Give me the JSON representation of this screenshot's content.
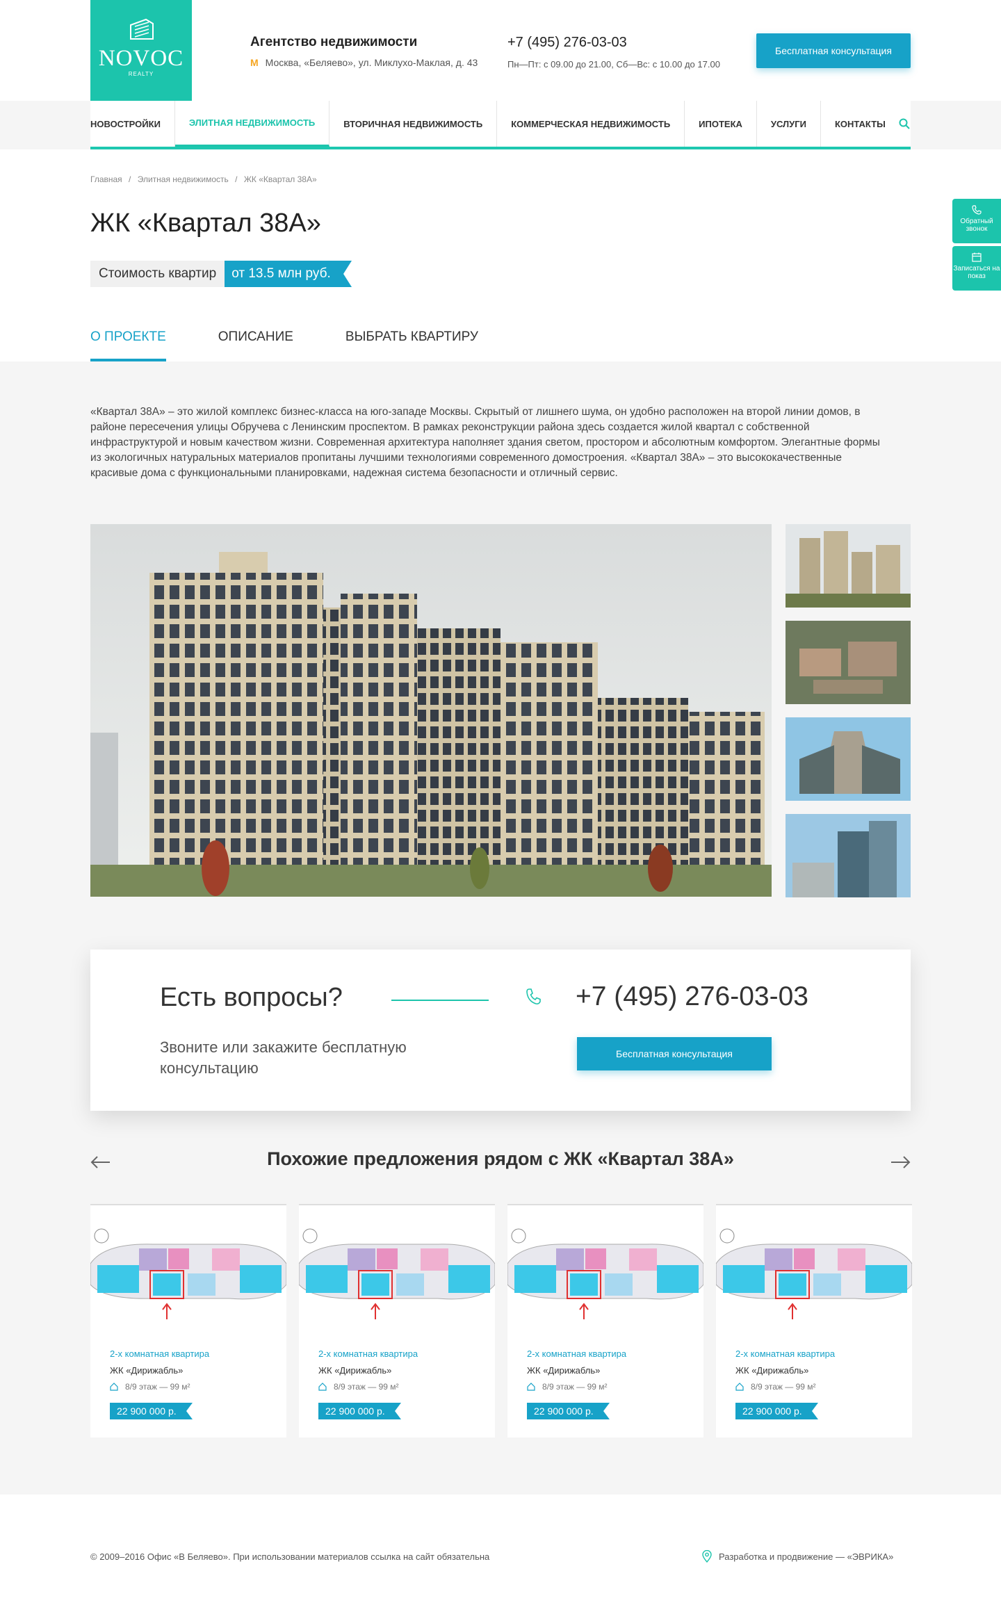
{
  "header": {
    "logo_name": "NOVOC",
    "logo_sub": "REALTY",
    "agency_title": "Агентство недвижимости",
    "metro": "М",
    "address": "Москва, «Беляево», ул. Миклухо-Маклая, д. 43",
    "phone": "+7 (495) 276-03-03",
    "hours": "Пн—Пт: с 09.00 до 21.00, Сб—Вс: с 10.00 до 17.00",
    "cta": "Бесплатная консультация"
  },
  "nav": {
    "items": [
      "Новостройки",
      "Элитная недвижимость",
      "Вторичная недвижимость",
      "Коммерческая недвижимость",
      "Ипотека",
      "Услуги",
      "Контакты"
    ]
  },
  "breadcrumbs": [
    "Главная",
    "/",
    "Элитная недвижимость",
    "/",
    "ЖК «Квартал 38А»"
  ],
  "page": {
    "title": "ЖК «Квартал 38А»",
    "price_label": "Стоимость квартир",
    "price_value": "от 13.5 млн руб.",
    "tabs": [
      "О проекте",
      "Описание",
      "Выбрать квартиру"
    ],
    "description": "«Квартал 38А» – это жилой комплекс бизнес-класса на юго-западе Москвы. Скрытый от лишнего шума, он удобно расположен на второй линии домов, в районе пересечения улицы Обручева с Ленинским проспектом. В рамках реконструкции района здесь создается жилой квартал с собственной инфраструктурой и новым качеством жизни. Современная архитектура наполняет здания светом, простором и абсолютным комфортом. Элегантные формы из экологичных натуральных материалов пропитаны лучшими технологиями современного домостроения. «Квартал 38А» – это высококачественные красивые дома с функциональными планировками, надежная система безопасности и отличный сервис."
  },
  "side_widgets": {
    "callback": "Обратный звонок",
    "viewing": "Записаться на показ"
  },
  "questions": {
    "title": "Есть вопросы?",
    "subtitle": "Звоните или закажите бесплатную консультацию",
    "phone": "+7 (495) 276-03-03",
    "button": "Бесплатная консультация"
  },
  "similar": {
    "title": "Похожие предложения рядом с ЖК «Квартал 38А»",
    "cards": [
      {
        "type": "2-х комнатная квартира",
        "complex": "ЖК «Дирижабль»",
        "floor": "8/9 этаж — 99 м²",
        "price": "22 900 000 р."
      },
      {
        "type": "2-х комнатная квартира",
        "complex": "ЖК «Дирижабль»",
        "floor": "8/9 этаж — 99 м²",
        "price": "22 900 000 р."
      },
      {
        "type": "2-х комнатная квартира",
        "complex": "ЖК «Дирижабль»",
        "floor": "8/9 этаж — 99 м²",
        "price": "22 900 000 р."
      },
      {
        "type": "2-х комнатная квартира",
        "complex": "ЖК «Дирижабль»",
        "floor": "8/9 этаж — 99 м²",
        "price": "22 900 000 р."
      }
    ]
  },
  "footer": {
    "copyright": "© 2009–2016 Офис «В Беляево». При использовании материалов ссылка на сайт обязательна",
    "developer": "Разработка и продвижение — «ЭВРИКА»"
  },
  "colors": {
    "accent": "#1cc4ac",
    "primary": "#17a2c8"
  }
}
